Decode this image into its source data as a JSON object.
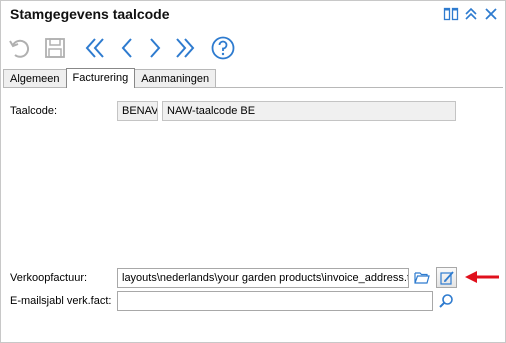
{
  "window": {
    "title": "Stamgegevens taalcode",
    "icons": [
      "split-view-icon",
      "collapse-up-icon",
      "close-icon"
    ]
  },
  "toolbar": {
    "buttons": [
      "undo-icon",
      "save-icon",
      "first-record-icon",
      "previous-record-icon",
      "next-record-icon",
      "last-record-icon",
      "help-icon"
    ]
  },
  "tabs": [
    {
      "label": "Algemeen",
      "active": false
    },
    {
      "label": "Facturering",
      "active": true
    },
    {
      "label": "Aanmaningen",
      "active": false
    }
  ],
  "form": {
    "taalcode": {
      "label": "Taalcode:",
      "code": "BENAV",
      "description": "NAW-taalcode BE"
    },
    "verkoopfactuur": {
      "label": "Verkoopfactuur:",
      "value": "layouts\\nederlands\\your garden products\\invoice_address.t"
    },
    "emailsjabl": {
      "label": "E-mailsjabl verk.fact:",
      "value": ""
    }
  },
  "colors": {
    "accent": "#2e7bcf",
    "arrow": "#e0101c"
  }
}
